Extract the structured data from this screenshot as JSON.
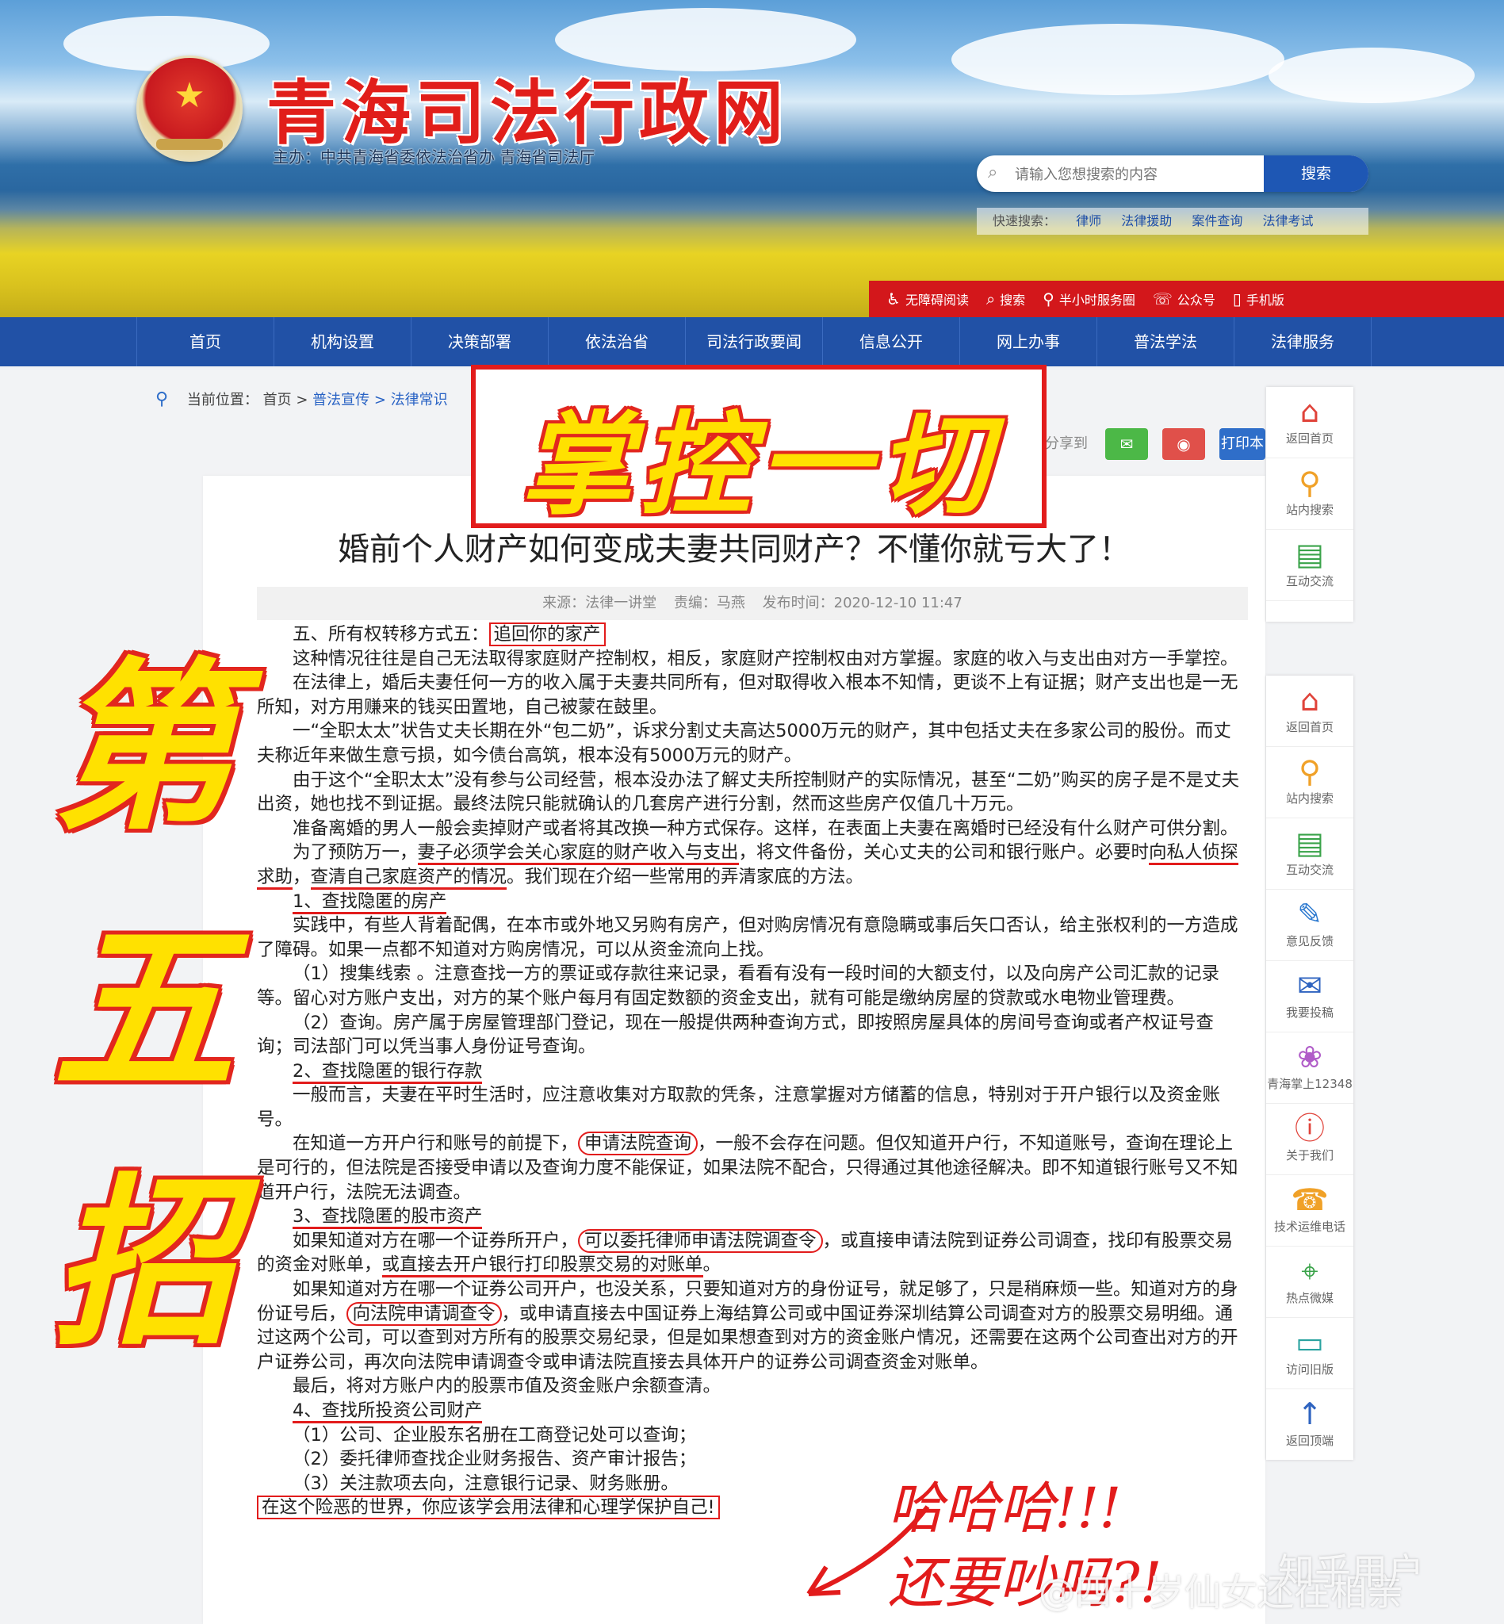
{
  "header": {
    "site_title": "青海司法行政网",
    "sponsor": "主办：中共青海省委依法治省办  青海省司法厅",
    "search_placeholder": "请输入您想搜索的内容",
    "search_button": "搜索",
    "quick_search_label": "快速搜索：",
    "quick_links": [
      "律师",
      "法律援助",
      "案件查询",
      "法律考试"
    ],
    "toolbar": [
      {
        "icon": "accessibility-icon",
        "glyph": "♿",
        "label": "无障碍阅读"
      },
      {
        "icon": "search-icon",
        "glyph": "⌕",
        "label": "搜索"
      },
      {
        "icon": "location-icon",
        "glyph": "⚲",
        "label": "半小时服务圈"
      },
      {
        "icon": "wechat-icon",
        "glyph": "☏",
        "label": "公众号"
      },
      {
        "icon": "mobile-icon",
        "glyph": "▯",
        "label": "手机版"
      }
    ]
  },
  "nav": [
    "首页",
    "机构设置",
    "决策部署",
    "依法治省",
    "司法行政要闻",
    "信息公开",
    "网上办事",
    "普法学法",
    "法律服务"
  ],
  "breadcrumb": {
    "label": "当前位置：",
    "home": "首页 >",
    "section": "普法宣传 > 法律常识"
  },
  "share": {
    "label": "分享到",
    "wechat": "✉",
    "weibo": "◉",
    "print": "打印本"
  },
  "overlay": {
    "stamp": "掌控一切",
    "side_chars": [
      "第",
      "五",
      "招"
    ],
    "handwriting_1": "哈哈哈!!!",
    "handwriting_2": "还要吵吗?!"
  },
  "article": {
    "title": "婚前个人财产如何变成夫妻共同财产？不懂你就亏大了！",
    "source": "来源：法律一讲堂",
    "editor": "责编：马燕",
    "published": "发布时间：2020-12-10 11:47",
    "p1a": "五、所有权转移方式五：",
    "p1b": "追回你的家产",
    "p2": "这种情况往往是自己无法取得家庭财产控制权，相反，家庭财产控制权由对方掌握。家庭的收入与支出由对方一手掌控。",
    "p3": "在法律上，婚后夫妻任何一方的收入属于夫妻共同所有，但对取得收入根本不知情，更谈不上有证据；财产支出也是一无所知，对方用赚来的钱买田置地，自己被蒙在鼓里。",
    "p4": "一“全职太太”状告丈夫长期在外“包二奶”，诉求分割丈夫高达5000万元的财产，其中包括丈夫在多家公司的股份。而丈夫称近年来做生意亏损，如今债台高筑，根本没有5000万元的财产。",
    "p5": "由于这个“全职太太”没有参与公司经营，根本没办法了解丈夫所控制财产的实际情况，甚至“二奶”购买的房子是不是丈夫出资，她也找不到证据。最终法院只能就确认的几套房产进行分割，然而这些房产仅值几十万元。",
    "p6": "准备离婚的男人一般会卖掉财产或者将其改换一种方式保存。这样，在表面上夫妻在离婚时已经没有什么财产可供分割。",
    "p7a": "为了预防万一，",
    "p7b": "妻子必须学会关心家庭的财产收入与支出",
    "p7c": "，将文件备份，关心丈夫的公司和银行账户。必要时",
    "p7d": "向私人侦探求助",
    "p7e": "，",
    "p7f": "查清自己家庭资产的情况",
    "p7g": "。我们现在介绍一些常用的弄清家底的方法。",
    "h1": "1、查找隐匿的房产",
    "p8": "实践中，有些人背着配偶，在本市或外地又另购有房产，但对购房情况有意隐瞒或事后矢口否认，给主张权利的一方造成了障碍。如果一点都不知道对方购房情况，可以从资金流向上找。",
    "p9": "（1）搜集线索 。注意查找一方的票证或存款往来记录，看看有没有一段时间的大额支付，以及向房产公司汇款的记录等。留心对方账户支出，对方的某个账户每月有固定数额的资金支出，就有可能是缴纳房屋的贷款或水电物业管理费。",
    "p10": "（2）查询。房产属于房屋管理部门登记，现在一般提供两种查询方式，即按照房屋具体的房间号查询或者产权证号查询；司法部门可以凭当事人身份证号查询。",
    "h2": "2、查找隐匿的银行存款",
    "p11": "一般而言，夫妻在平时生活时，应注意收集对方取款的凭条，注意掌握对方储蓄的信息，特别对于开户银行以及资金账号。",
    "p12a": "在知道一方开户行和账号的前提下，",
    "p12b": "申请法院查询",
    "p12c": "，一般不会存在问题。但仅知道开户行，不知道账号，查询在理论上是可行的，但法院是否接受申请以及查询力度不能保证，如果法院不配合，只得通过其他途径解决。即不知道银行账号又不知道开户行，法院无法调查。",
    "h3": "3、查找隐匿的股市资产",
    "p13a": "如果知道对方在哪一个证券所开户，",
    "p13b": "可以委托律师申请法院调查令",
    "p13c": "，或直接申请法院到证券公司调查，找印有股票交易的资金对账单，",
    "p13d": "或直接去开户银行打印股票交易的对账单",
    "p13e": "。",
    "p14a": "如果知道对方在哪一个证券公司开户，也没关系，只要知道对方的身份证号，就足够了，只是稍麻烦一些。知道对方的身份证号后，",
    "p14b": "向法院申请调查令",
    "p14c": "，或申请直接去中国证券上海结算公司或中国证券深圳结算公司调查对方的股票交易明细。通过这两个公司，可以查到对方所有的股票交易纪录，但是如果想查到对方的资金账户情况，还需要在这两个公司查出对方的开户证券公司，再次向法院申请调查令或申请法院直接去具体开户的证券公司调查资金对账单。",
    "p15": "最后，将对方账户内的股票市值及资金账户余额查清。",
    "h4": "4、查找所投资公司财产",
    "p16": "（1）公司、企业股东名册在工商登记处可以查询；",
    "p17": "（2）委托律师查找企业财务报告、资产审计报告；",
    "p18": "（3）关注款项去向，注意银行记录、财务账册。",
    "p19": "在这个险恶的世界，你应该学会用法律和心理学保护自己!"
  },
  "right_bar_top": [
    {
      "icon": "home-icon",
      "glyph": "⌂",
      "label": "返回首页",
      "color": "#e0433a"
    },
    {
      "icon": "search-icon",
      "glyph": "⚲",
      "label": "站内搜索",
      "color": "#f0a128"
    },
    {
      "icon": "chat-icon",
      "glyph": "▤",
      "label": "互动交流",
      "color": "#3aa34a"
    }
  ],
  "right_bar_bottom": [
    {
      "icon": "home-icon",
      "glyph": "⌂",
      "label": "返回首页",
      "color": "#e0433a"
    },
    {
      "icon": "search-icon",
      "glyph": "⚲",
      "label": "站内搜索",
      "color": "#f0a128"
    },
    {
      "icon": "chat-icon",
      "glyph": "▤",
      "label": "互动交流",
      "color": "#3aa34a"
    },
    {
      "icon": "feedback-icon",
      "glyph": "✎",
      "label": "意见反馈",
      "color": "#2f7bd0"
    },
    {
      "icon": "mail-icon",
      "glyph": "✉",
      "label": "我要投稿",
      "color": "#2f64c0"
    },
    {
      "icon": "bubble-icon",
      "glyph": "❀",
      "label": "青海掌上12348",
      "color": "#b05cc8"
    },
    {
      "icon": "info-icon",
      "glyph": "ⓘ",
      "label": "关于我们",
      "color": "#e0433a"
    },
    {
      "icon": "phone-icon",
      "glyph": "☎",
      "label": "技术运维电话",
      "color": "#f0a128"
    },
    {
      "icon": "satellite-icon",
      "glyph": "⌖",
      "label": "热点微媒",
      "color": "#3aa34a"
    },
    {
      "icon": "monitor-icon",
      "glyph": "▭",
      "label": "访问旧版",
      "color": "#2aa3a0"
    },
    {
      "icon": "arrow-up-icon",
      "glyph": "↑",
      "label": "返回顶端",
      "color": "#2f64c0"
    }
  ],
  "watermark": {
    "weibo": "@四十岁仙女还在相亲",
    "zhihu": "知乎用户"
  }
}
